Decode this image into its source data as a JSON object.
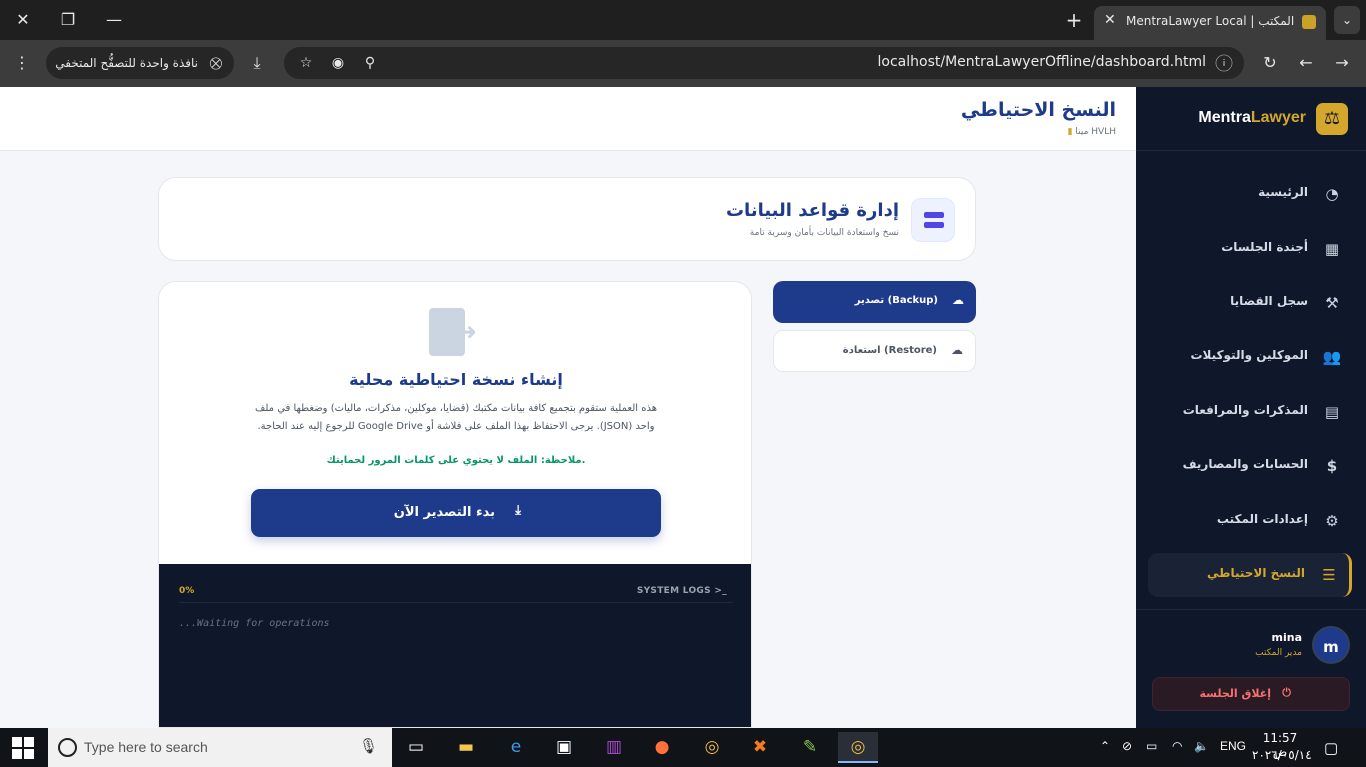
{
  "browser": {
    "tab_title": "MentraLawyer Local | لوحة التحكم في المكتب",
    "url": "localhost/MentraLawyerOffline/dashboard.html",
    "incognito_label": "نافذة واحدة للتصفُّح المتخفي"
  },
  "sidebar": {
    "brand_main": "Mentra",
    "brand_accent": "Lawyer",
    "items": [
      {
        "label": "الرئيسية",
        "icon": "pie-chart-icon"
      },
      {
        "label": "أجندة الجلسات",
        "icon": "calendar-icon"
      },
      {
        "label": "سجل القضايا",
        "icon": "gavel-icon"
      },
      {
        "label": "الموكلين والتوكيلات",
        "icon": "users-icon"
      },
      {
        "label": "المذكرات والمرافعات",
        "icon": "file-icon"
      },
      {
        "label": "الحسابات والمصاريف",
        "icon": "invoice-icon"
      },
      {
        "label": "إعدادات المكتب",
        "icon": "gear-icon"
      },
      {
        "label": "النسخ الاحتياطي",
        "icon": "database-icon"
      }
    ],
    "active_item": "النسخ الاحتياطي",
    "user": {
      "initial": "m",
      "name": "mina",
      "role": "مدير المكتب"
    },
    "logout_label": "إغلاق الجلسة"
  },
  "header": {
    "title": "النسخ الاحتياطي",
    "office_name": "مينا",
    "office_code": "HVLH"
  },
  "db_card": {
    "title": "إدارة قواعد البيانات",
    "subtitle": "نسخ واستعادة البيانات بأمان وسرية تامة"
  },
  "tabs": {
    "export_label": "تصدير (Backup)",
    "restore_label": "استعادة (Restore)"
  },
  "export": {
    "title": "إنشاء نسخة احتياطية محلية",
    "description": "هذه العملية ستقوم بتجميع كافة بيانات مكتبك (قضايا، موكلين، مذكرات، ماليات) وضغطها في ملف واحد (JSON). يرجى الاحتفاظ بهذا الملف على فلاشة أو Google Drive للرجوع إليه عند الحاجة.",
    "note": "ملاحظة: الملف لا يحتوي على كلمات المرور لحمايتك.",
    "button_label": "بدء التصدير الآن"
  },
  "console": {
    "label": "SYSTEM LOGS",
    "progress": "0%",
    "waiting": "...Waiting for operations"
  },
  "taskbar": {
    "search_placeholder": "Type here to search",
    "lang": "ENG",
    "time": "11:57 ص",
    "date": "٢٠٢٦/٠٥/١٤"
  },
  "colors": {
    "primary": "#1e3a8a",
    "accent": "#d4a72c",
    "sidebar_bg": "#0f172a",
    "success": "#059669"
  }
}
